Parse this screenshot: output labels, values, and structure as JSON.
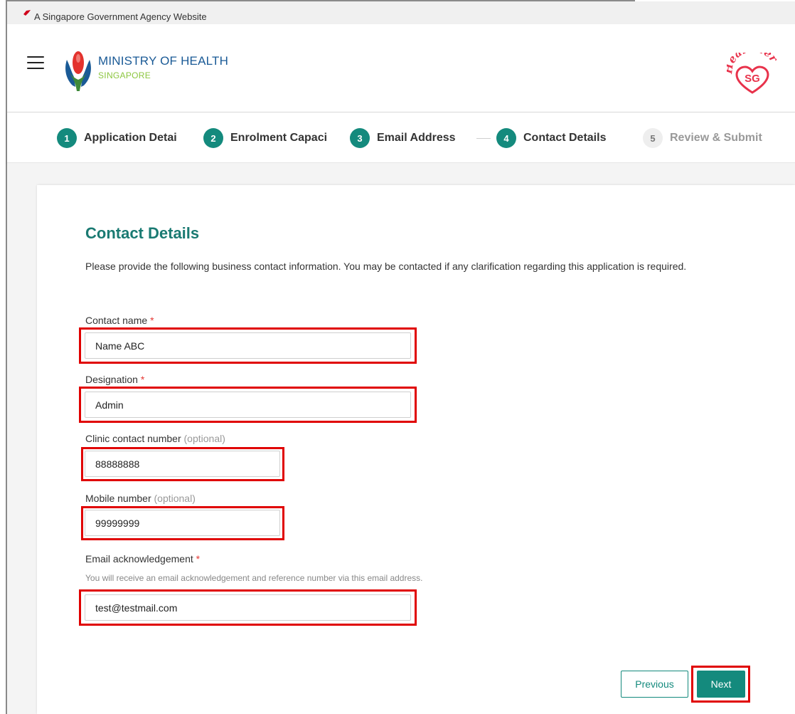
{
  "gov_bar": {
    "text": "A Singapore Government Agency Website"
  },
  "header": {
    "ministry_title": "MINISTRY OF HEALTH",
    "ministry_subtitle": "SINGAPORE",
    "right_logo_top": "Healthier",
    "right_logo_inner": "SG"
  },
  "steps": [
    {
      "num": "1",
      "label": "Application Detai",
      "state": "done"
    },
    {
      "num": "2",
      "label": "Enrolment Capaci",
      "state": "done"
    },
    {
      "num": "3",
      "label": "Email Address",
      "state": "done"
    },
    {
      "num": "4",
      "label": "Contact Details",
      "state": "current"
    },
    {
      "num": "5",
      "label": "Review & Submit",
      "state": "inactive"
    }
  ],
  "form": {
    "title": "Contact Details",
    "description": "Please provide the following business contact information. You may be contacted if any clarification regarding this application is required.",
    "required_mark": "*",
    "optional_mark": "(optional)",
    "contact_name": {
      "label": "Contact name",
      "value": "Name ABC"
    },
    "designation": {
      "label": "Designation",
      "value": "Admin"
    },
    "clinic_contact": {
      "label": "Clinic contact number",
      "value": "88888888"
    },
    "mobile": {
      "label": "Mobile number",
      "value": "99999999"
    },
    "email_ack": {
      "label": "Email acknowledgement",
      "help": "You will receive an email acknowledgement and reference number via this email address.",
      "value": "test@testmail.com"
    }
  },
  "buttons": {
    "previous": "Previous",
    "next": "Next"
  },
  "colors": {
    "primary": "#148a7d",
    "title": "#1a7a72",
    "highlight": "#e00000",
    "required": "#e53935"
  }
}
